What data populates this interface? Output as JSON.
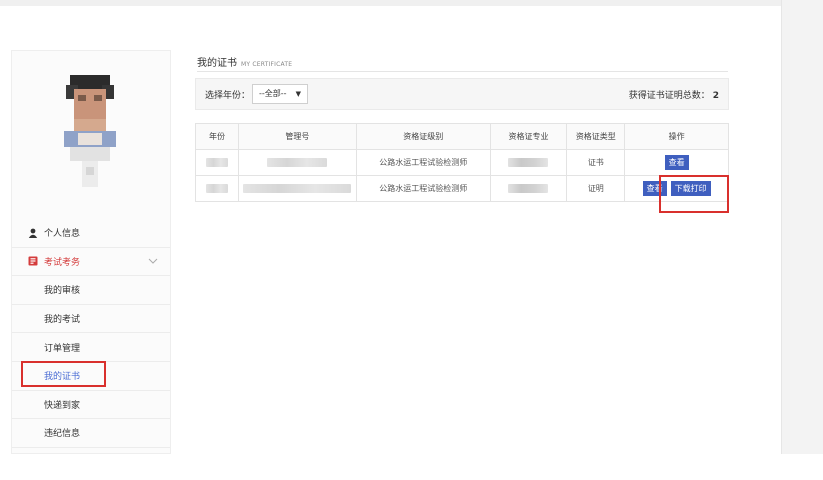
{
  "page": {
    "title": "我的证书",
    "title_en": "MY CERTIFICATE"
  },
  "sidebar": {
    "items": [
      {
        "label": "个人信息",
        "icon": "user-icon"
      },
      {
        "label": "考试考务",
        "icon": "exam-icon",
        "expanded": true
      }
    ],
    "sub_items": [
      {
        "label": "我的审核"
      },
      {
        "label": "我的考试"
      },
      {
        "label": "订单管理"
      },
      {
        "label": "我的证书",
        "selected": true
      },
      {
        "label": "快递到家"
      },
      {
        "label": "违纪信息"
      }
    ]
  },
  "filter": {
    "year_label": "选择年份：",
    "year_value": "--全部--",
    "total_label": "获得证书证明总数：",
    "total_value": "2"
  },
  "table": {
    "headers": [
      "年份",
      "管理号",
      "资格证级别",
      "资格证专业",
      "资格证类型",
      "操作"
    ],
    "rows": [
      {
        "level": "公路水运工程试验检测师",
        "type": "证书",
        "actions": [
          "查看"
        ]
      },
      {
        "level": "公路水运工程试验检测师",
        "type": "证明",
        "actions": [
          "查看",
          "下载打印"
        ]
      }
    ]
  },
  "colors": {
    "accent": "#3f5fbf",
    "active_menu": "#d43c3c",
    "highlight": "#d9302d"
  }
}
